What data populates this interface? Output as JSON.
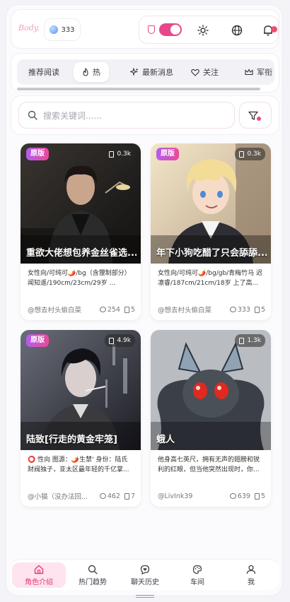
{
  "header": {
    "logo_text": "Body.",
    "coins": "333"
  },
  "tabs": [
    {
      "label": "推荐阅读",
      "icon": ""
    },
    {
      "label": "热",
      "icon": "flame-icon"
    },
    {
      "label": "最新消息",
      "icon": "sparkle-icon"
    },
    {
      "label": "关注",
      "icon": "heart-icon"
    },
    {
      "label": "军衔",
      "icon": "crown-icon"
    }
  ],
  "search": {
    "placeholder": "搜索关键词......"
  },
  "cards": [
    {
      "badge": "原版",
      "reads": "0.3k",
      "title": "重欲大佬想包养金丝雀选...",
      "desc": "女性向/可纯可🌶️/bg（含狸制部分） 闻知遥/190cm/23cm/29岁 ...",
      "author": "@想去村头偷白菜",
      "comments": "254",
      "chapters": "5"
    },
    {
      "badge": "原版",
      "reads": "0.3k",
      "title": "年下小狗吃醋了只会舔舔...",
      "desc": "女性向/可纯可🌶️/bg/gb/青梅竹马 迟凛睿/187cm/21cm/18岁 上了高...",
      "author": "@想去村头偷白菜",
      "comments": "333",
      "chapters": "5"
    },
    {
      "badge": "原版",
      "reads": "4.9k",
      "title": "陆致[行走的黄金牢笼]",
      "desc": "⭕ 性向 图源：🌶️生禁' 身份：陆氏财阀独子，亚太区最年轻的千亿掌...",
      "author": "@小猫（没办法回...",
      "comments": "462",
      "chapters": "7"
    },
    {
      "badge": "",
      "reads": "1.3k",
      "title": "蛾人",
      "desc": "他身高七英尺，拥有无声的翅膀和锐利的红眼，但当他突然出现时，你...",
      "author": "@LivInk39",
      "comments": "639",
      "chapters": "5"
    }
  ],
  "bottom_nav": [
    {
      "label": "角色介绍",
      "icon": "home-icon",
      "active": true
    },
    {
      "label": "热门趋势",
      "icon": "search-icon",
      "active": false
    },
    {
      "label": "聊天历史",
      "icon": "chat-heart-icon",
      "active": false
    },
    {
      "label": "车间",
      "icon": "palette-icon",
      "active": false
    },
    {
      "label": "我",
      "icon": "user-icon",
      "active": false
    }
  ],
  "colors": {
    "accent": "#e8468a",
    "badge_gradient_start": "#b45cf2",
    "badge_gradient_end": "#ec4899",
    "active_nav_bg": "#fde4ee"
  }
}
